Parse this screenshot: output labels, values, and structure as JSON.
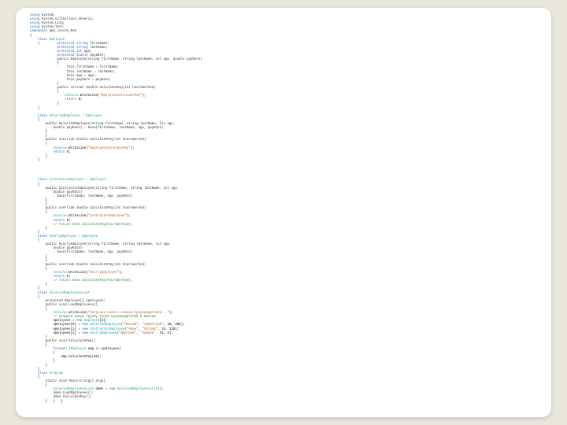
{
  "code": {
    "usings": [
      "System",
      "System.Collections.Generic",
      "System.Linq",
      "System.Text"
    ],
    "namespace": "app_lesson_No5",
    "classes": {
      "Employee": {
        "fields": [
          {
            "mod": "protected",
            "type": "string",
            "name": "firstName"
          },
          {
            "mod": "protected",
            "type": "string",
            "name": "lastName"
          },
          {
            "mod": "protected",
            "type": "int",
            "name": "age"
          },
          {
            "mod": "protected",
            "type": "double",
            "name": "payRate"
          }
        ],
        "ctor_sig": "public Employee(string firstName, string lastName, int age, double payRate)",
        "ctor_body": [
          "this.firstName = firstName;",
          "this.lastName = lastName;",
          "this.age = age;",
          "this.payRate = payRate;"
        ],
        "calc_sig": "public virtual double CalculatePay(int hoursWorked)",
        "calc_body": [
          "Console.WriteLine(\"EmployeeCalculatePay\");",
          "return 0;"
        ]
      },
      "SalariedEmployee": {
        "extends": "Employee",
        "ctor_sig": "public SalariedEmployee(string firstName, string lastName, int age,",
        "ctor_sig2": "double payRate) : base(firstName, lastName, age, payRate)",
        "calc_sig": "public override double CalculatePay(int hoursWorked)",
        "calc_body": [
          "Console.WriteLine(\"EmployeeCalculatePay\");",
          "return 0;"
        ]
      },
      "ContractorEmployee": {
        "extends": "Employee",
        "ctor_sig": "public ContractorEmployee(string firstName, string lastName, int age,",
        "ctor_sig2": "double payRate)",
        "ctor_base": ": base(firstName, lastName, age, payRate)",
        "calc_sig": "public override double CalculatePay(int hoursWorked)",
        "calc_body": [
          "Console.WriteLine(\"ContractorEmployee\");",
          "return 0;",
          "// return base.CalculatePay(hoursWorked);"
        ]
      },
      "HourlyEmployee": {
        "extends": "Employee",
        "ctor_sig": "public HourlyEmployee(string firstName, string lastName, int age,",
        "ctor_sig2": "double payRate)",
        "ctor_base": ": base(firstName, lastName, age, payRate)",
        "calc_sig": "public override double CalculatePay(int hoursWorked)",
        "calc_body": [
          "Console.WriteLine(\"HourlyEmployee\");",
          "return 0;",
          "// return base.CalculatePay(hoursWorked);"
        ]
      },
      "SalariedEmployeesList": {
        "field": "protected Employee[] epmloyees;",
        "load_sig": "public void LoadEmployees()",
        "load_body": [
          "Console.WriteLine(\"Загрузка нового списка производителей...\");",
          "// Создать новую группу типов производителей в массив",
          "epmloyees = new Employee[3];",
          "epmloyees[0] = new SalariedEmployee(\"Максим\", \"Завитский\", 29, 200);",
          "epmloyees[1] = new ContractorEmployee(\"Иван\", \"Петров\", 33, 120);",
          "epmloyees[2] = new HourlyEmployee(\"Дмитрий\", \"Зайцев\", 43, 5);"
        ],
        "calc_sig": "public void CalculatePay()",
        "calc_body": [
          "foreach (Employee emp in epmloyees)",
          "{",
          "    emp.CalculatePay(40);",
          "}"
        ]
      },
      "Program": {
        "main_sig": "static void Main(string[] args)",
        "main_body": [
          "SalariedEmployeesList demo = new SalariedEmployeesList();",
          "demo.LoadEmployees();",
          "demo.CalculatePay();"
        ]
      }
    }
  }
}
